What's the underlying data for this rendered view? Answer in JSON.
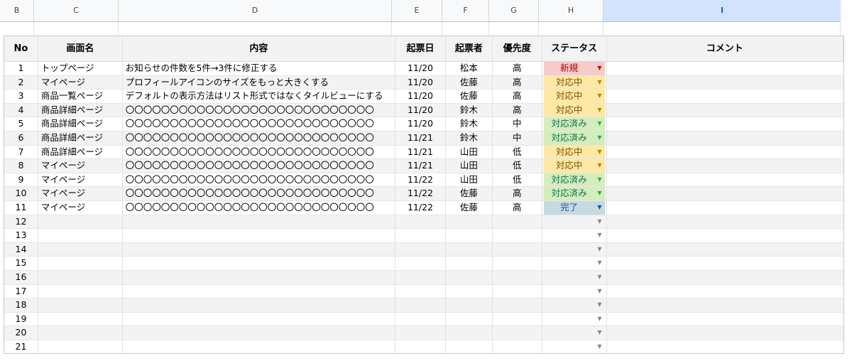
{
  "columns": [
    "B",
    "C",
    "D",
    "E",
    "F",
    "G",
    "H",
    "I"
  ],
  "selected_column": "I",
  "headers": {
    "no": "No",
    "screen": "画面名",
    "content": "内容",
    "date": "起票日",
    "author": "起票者",
    "priority": "優先度",
    "status": "ステータス",
    "comment": "コメント"
  },
  "status_colors": {
    "新規": {
      "bg": "#f4cccc",
      "fg": "#b10202",
      "arrow": "#cc0000"
    },
    "対応中": {
      "bg": "#fde9a5",
      "fg": "#7a4b00",
      "arrow": "#b78400"
    },
    "対応済み": {
      "bg": "#d4edbc",
      "fg": "#11734b",
      "arrow": "#34a853"
    },
    "完了": {
      "bg": "#c6dbe1",
      "fg": "#0a53a8",
      "arrow": "#0a53a8"
    }
  },
  "rows": [
    {
      "no": "1",
      "screen": "トップページ",
      "content": "お知らせの件数を5件→3件に修正する",
      "date": "11/20",
      "author": "松本",
      "priority": "高",
      "status": "新規"
    },
    {
      "no": "2",
      "screen": "マイページ",
      "content": "プロフィールアイコンのサイズをもっと大きくする",
      "date": "11/20",
      "author": "佐藤",
      "priority": "高",
      "status": "対応中"
    },
    {
      "no": "3",
      "screen": "商品一覧ページ",
      "content": "デフォルトの表示方法はリスト形式ではなくタイルビューにする",
      "date": "11/20",
      "author": "佐藤",
      "priority": "高",
      "status": "対応中"
    },
    {
      "no": "4",
      "screen": "商品詳細ページ",
      "content": "〇〇〇〇〇〇〇〇〇〇〇〇〇〇〇〇〇〇〇〇〇〇〇〇〇〇〇〇",
      "date": "11/20",
      "author": "鈴木",
      "priority": "高",
      "status": "対応中"
    },
    {
      "no": "5",
      "screen": "商品詳細ページ",
      "content": "〇〇〇〇〇〇〇〇〇〇〇〇〇〇〇〇〇〇〇〇〇〇〇〇〇〇〇〇",
      "date": "11/20",
      "author": "鈴木",
      "priority": "中",
      "status": "対応済み"
    },
    {
      "no": "6",
      "screen": "商品詳細ページ",
      "content": "〇〇〇〇〇〇〇〇〇〇〇〇〇〇〇〇〇〇〇〇〇〇〇〇〇〇〇〇",
      "date": "11/21",
      "author": "鈴木",
      "priority": "中",
      "status": "対応済み"
    },
    {
      "no": "7",
      "screen": "商品詳細ページ",
      "content": "〇〇〇〇〇〇〇〇〇〇〇〇〇〇〇〇〇〇〇〇〇〇〇〇〇〇〇〇",
      "date": "11/21",
      "author": "山田",
      "priority": "低",
      "status": "対応中"
    },
    {
      "no": "8",
      "screen": "マイページ",
      "content": "〇〇〇〇〇〇〇〇〇〇〇〇〇〇〇〇〇〇〇〇〇〇〇〇〇〇〇〇",
      "date": "11/21",
      "author": "山田",
      "priority": "低",
      "status": "対応中"
    },
    {
      "no": "9",
      "screen": "マイページ",
      "content": "〇〇〇〇〇〇〇〇〇〇〇〇〇〇〇〇〇〇〇〇〇〇〇〇〇〇〇〇",
      "date": "11/22",
      "author": "山田",
      "priority": "低",
      "status": "対応済み"
    },
    {
      "no": "10",
      "screen": "マイページ",
      "content": "〇〇〇〇〇〇〇〇〇〇〇〇〇〇〇〇〇〇〇〇〇〇〇〇〇〇〇〇",
      "date": "11/22",
      "author": "佐藤",
      "priority": "高",
      "status": "対応済み"
    },
    {
      "no": "11",
      "screen": "マイページ",
      "content": "〇〇〇〇〇〇〇〇〇〇〇〇〇〇〇〇〇〇〇〇〇〇〇〇〇〇〇〇",
      "date": "11/22",
      "author": "佐藤",
      "priority": "高",
      "status": "完了"
    },
    {
      "no": "12",
      "screen": "",
      "content": "",
      "date": "",
      "author": "",
      "priority": "",
      "status": ""
    },
    {
      "no": "13",
      "screen": "",
      "content": "",
      "date": "",
      "author": "",
      "priority": "",
      "status": ""
    },
    {
      "no": "14",
      "screen": "",
      "content": "",
      "date": "",
      "author": "",
      "priority": "",
      "status": ""
    },
    {
      "no": "15",
      "screen": "",
      "content": "",
      "date": "",
      "author": "",
      "priority": "",
      "status": ""
    },
    {
      "no": "16",
      "screen": "",
      "content": "",
      "date": "",
      "author": "",
      "priority": "",
      "status": ""
    },
    {
      "no": "17",
      "screen": "",
      "content": "",
      "date": "",
      "author": "",
      "priority": "",
      "status": ""
    },
    {
      "no": "18",
      "screen": "",
      "content": "",
      "date": "",
      "author": "",
      "priority": "",
      "status": ""
    },
    {
      "no": "19",
      "screen": "",
      "content": "",
      "date": "",
      "author": "",
      "priority": "",
      "status": ""
    },
    {
      "no": "20",
      "screen": "",
      "content": "",
      "date": "",
      "author": "",
      "priority": "",
      "status": ""
    },
    {
      "no": "21",
      "screen": "",
      "content": "",
      "date": "",
      "author": "",
      "priority": "",
      "status": ""
    }
  ]
}
